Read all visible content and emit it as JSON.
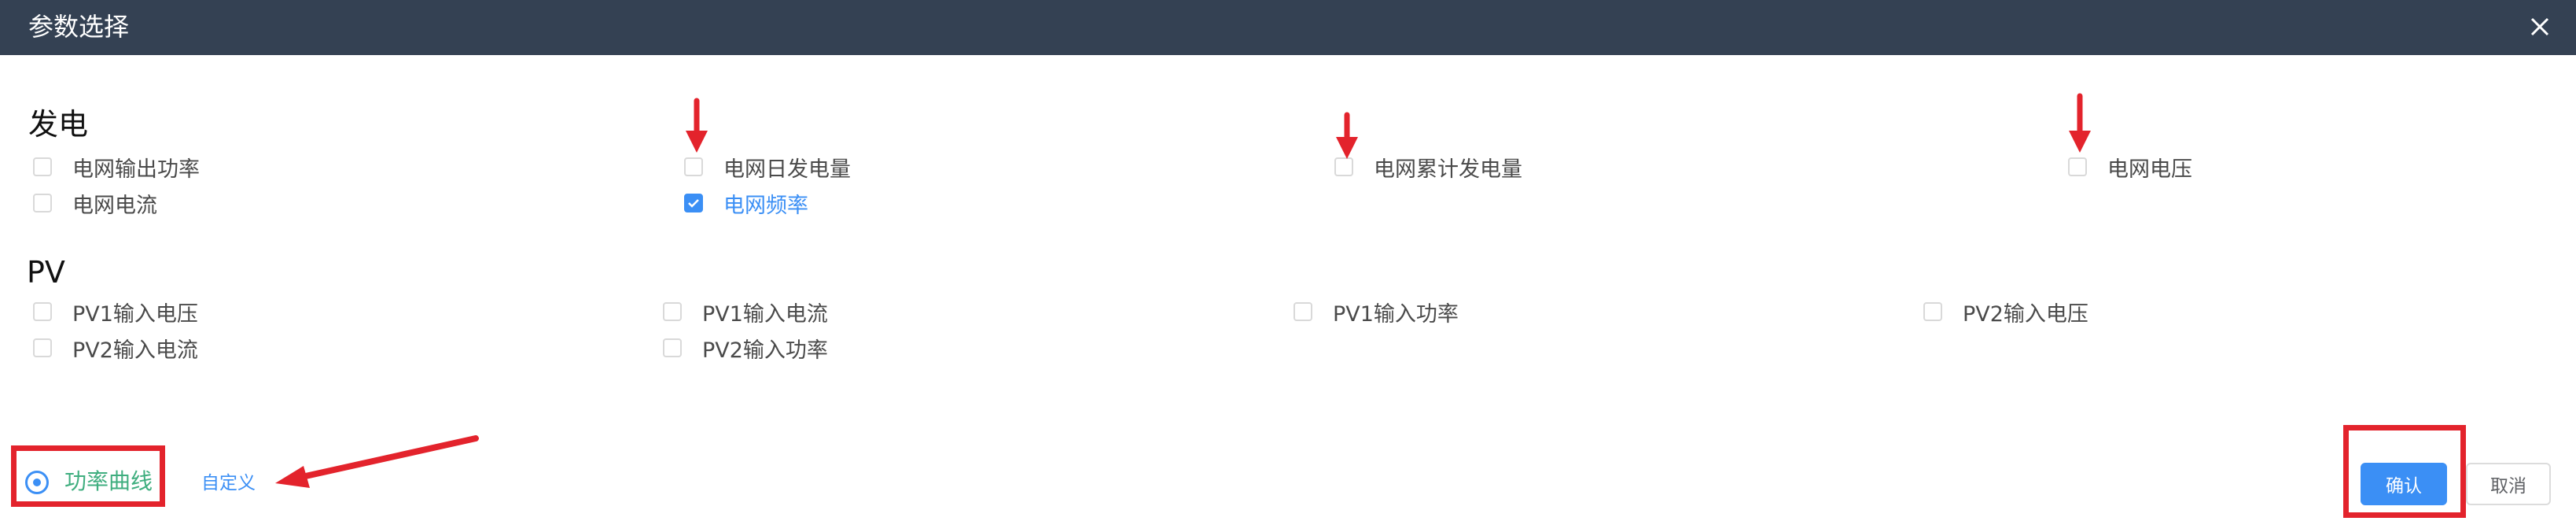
{
  "dialog": {
    "title": "参数选择",
    "close_icon": "close-icon"
  },
  "sections": [
    {
      "title": "发电",
      "items": [
        {
          "label": "电网输出功率",
          "checked": false
        },
        {
          "label": "电网日发电量",
          "checked": false
        },
        {
          "label": "电网累计发电量",
          "checked": false
        },
        {
          "label": "电网电压",
          "checked": false
        },
        {
          "label": "电网电流",
          "checked": false
        },
        {
          "label": "电网频率",
          "checked": true
        }
      ]
    },
    {
      "title": "PV",
      "items": [
        {
          "label": "PV1输入电压",
          "checked": false
        },
        {
          "label": "PV1输入电流",
          "checked": false
        },
        {
          "label": "PV1输入功率",
          "checked": false
        },
        {
          "label": "PV2输入电压",
          "checked": false
        },
        {
          "label": "PV2输入电流",
          "checked": false
        },
        {
          "label": "PV2输入功率",
          "checked": false
        }
      ]
    }
  ],
  "footer": {
    "mode_radio_label": "功率曲线",
    "mode_selected": true,
    "custom_link": "自定义",
    "confirm_button": "确认",
    "cancel_button": "取消"
  },
  "colors": {
    "titlebar": "#344153",
    "accent": "#3b8ff5",
    "radio_label": "#3fae7f",
    "annotation": "#e3232c"
  }
}
